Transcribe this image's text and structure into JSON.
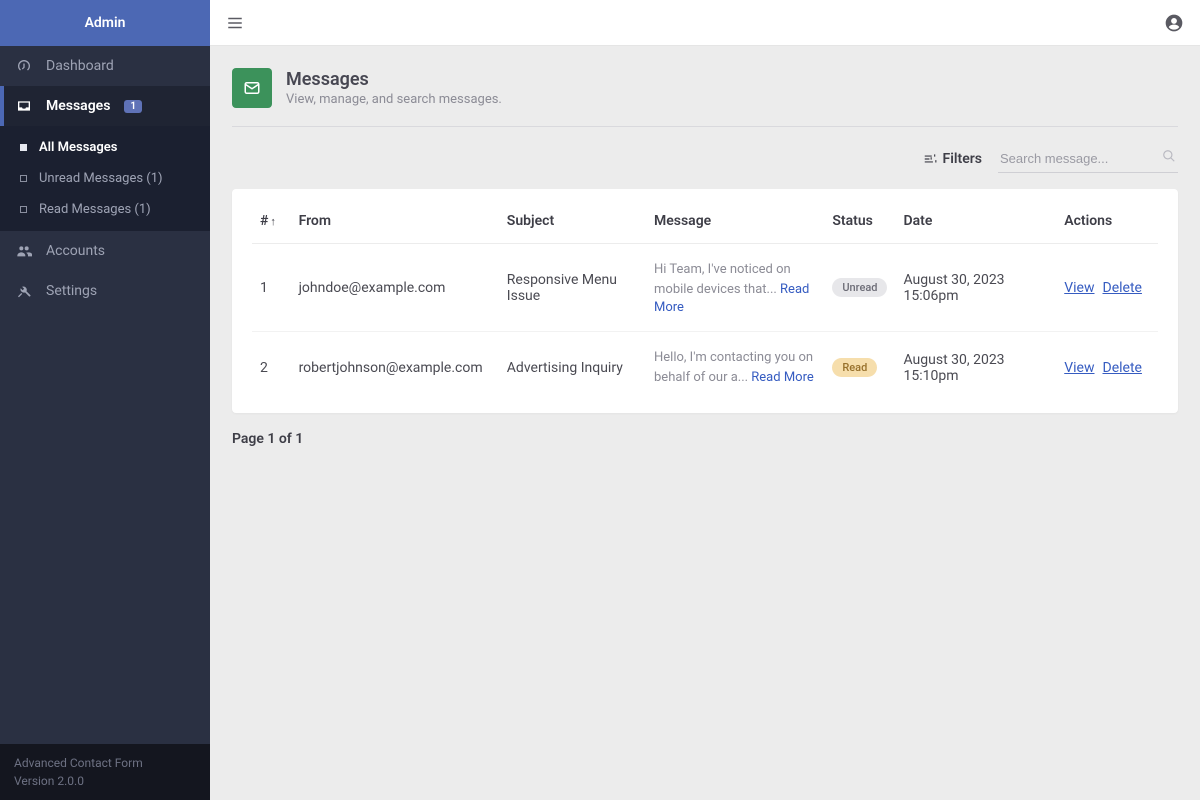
{
  "app_name": "Admin",
  "sidebar": {
    "items": [
      {
        "label": "Dashboard"
      },
      {
        "label": "Messages",
        "badge": "1"
      },
      {
        "label": "Accounts"
      },
      {
        "label": "Settings"
      }
    ],
    "sub_messages": [
      {
        "label": "All Messages"
      },
      {
        "label": "Unread Messages (1)"
      },
      {
        "label": "Read Messages (1)"
      }
    ]
  },
  "footer": {
    "line1": "Advanced Contact Form",
    "line2": "Version 2.0.0"
  },
  "page": {
    "title": "Messages",
    "subtitle": "View, manage, and search messages."
  },
  "toolbar": {
    "filters_label": "Filters",
    "search_placeholder": "Search message..."
  },
  "table": {
    "headers": {
      "num": "#",
      "from": "From",
      "subject": "Subject",
      "message": "Message",
      "status": "Status",
      "date": "Date",
      "actions": "Actions"
    },
    "read_more": "Read More",
    "action_view": "View",
    "action_delete": "Delete",
    "rows": [
      {
        "num": "1",
        "from": "johndoe@example.com",
        "subject": "Responsive Menu Issue",
        "snippet": "Hi Team, I've noticed on mobile devices that... ",
        "status_label": "Unread",
        "status_class": "status-unread",
        "date": "August 30, 2023 15:06pm"
      },
      {
        "num": "2",
        "from": "robertjohnson@example.com",
        "subject": "Advertising Inquiry",
        "snippet": "Hello, I'm contacting you on behalf of our a... ",
        "status_label": "Read",
        "status_class": "status-read",
        "date": "August 30, 2023 15:10pm"
      }
    ]
  },
  "pagination": "Page 1 of 1"
}
